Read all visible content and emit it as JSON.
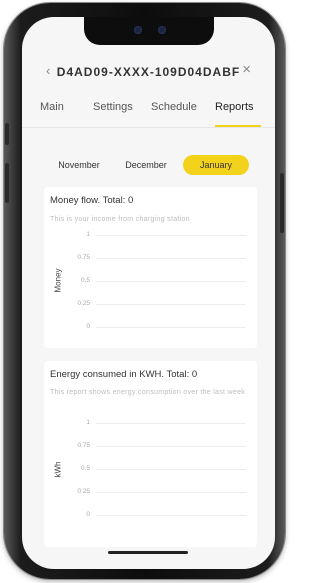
{
  "header": {
    "back_icon": "‹",
    "title": "D4AD09-XXXX-109D04DABF",
    "close_icon": "×"
  },
  "tabs": [
    {
      "label": "Main",
      "active": false
    },
    {
      "label": "Settings",
      "active": false
    },
    {
      "label": "Schedule",
      "active": false
    },
    {
      "label": "Reports",
      "active": true
    }
  ],
  "months": [
    {
      "label": "November",
      "active": false
    },
    {
      "label": "December",
      "active": false
    },
    {
      "label": "January",
      "active": true
    }
  ],
  "money_chart": {
    "title": "Money flow. Total: 0",
    "subtitle": "This is your income from charging station",
    "ylabel": "Money",
    "ticks": [
      "1",
      "0.75",
      "0.5",
      "0.25",
      "0"
    ]
  },
  "energy_chart": {
    "title": "Energy consumed in KWH. Total: 0",
    "subtitle": "This report shows energy consumption over the last week",
    "ylabel": "kWh",
    "ticks": [
      "1",
      "0.75",
      "0.5",
      "0.25",
      "0"
    ]
  },
  "chart_data": [
    {
      "type": "line",
      "title": "Money flow. Total: 0",
      "ylabel": "Money",
      "ylim": [
        0,
        1
      ],
      "yticks": [
        1,
        0.75,
        0.5,
        0.25,
        0
      ],
      "series": [],
      "grid": true
    },
    {
      "type": "line",
      "title": "Energy consumed in KWH. Total: 0",
      "ylabel": "kWh",
      "ylim": [
        0,
        1
      ],
      "yticks": [
        1,
        0.75,
        0.5,
        0.25,
        0
      ],
      "series": [],
      "grid": true
    }
  ],
  "colors": {
    "accent": "#f2d21b",
    "screen_bg": "#f6f6f6",
    "card_bg": "#ffffff"
  }
}
